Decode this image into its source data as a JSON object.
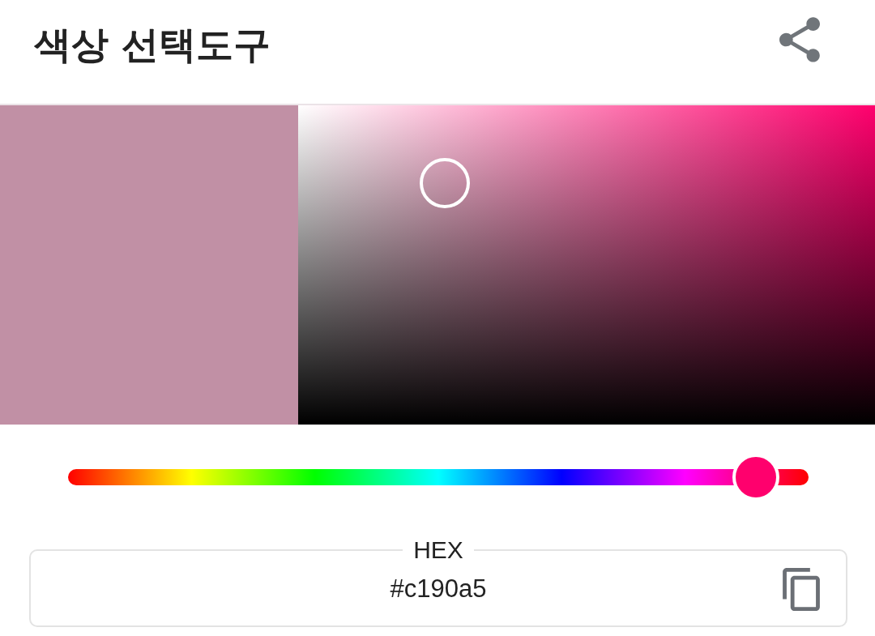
{
  "app_bar": {
    "title": "색상 선택도구"
  },
  "picker": {
    "color": "#c190a5"
  },
  "hue_slider": {
    "level": 0.929
  },
  "hex_field": {
    "label": "HEX",
    "value": "#c190a5"
  }
}
